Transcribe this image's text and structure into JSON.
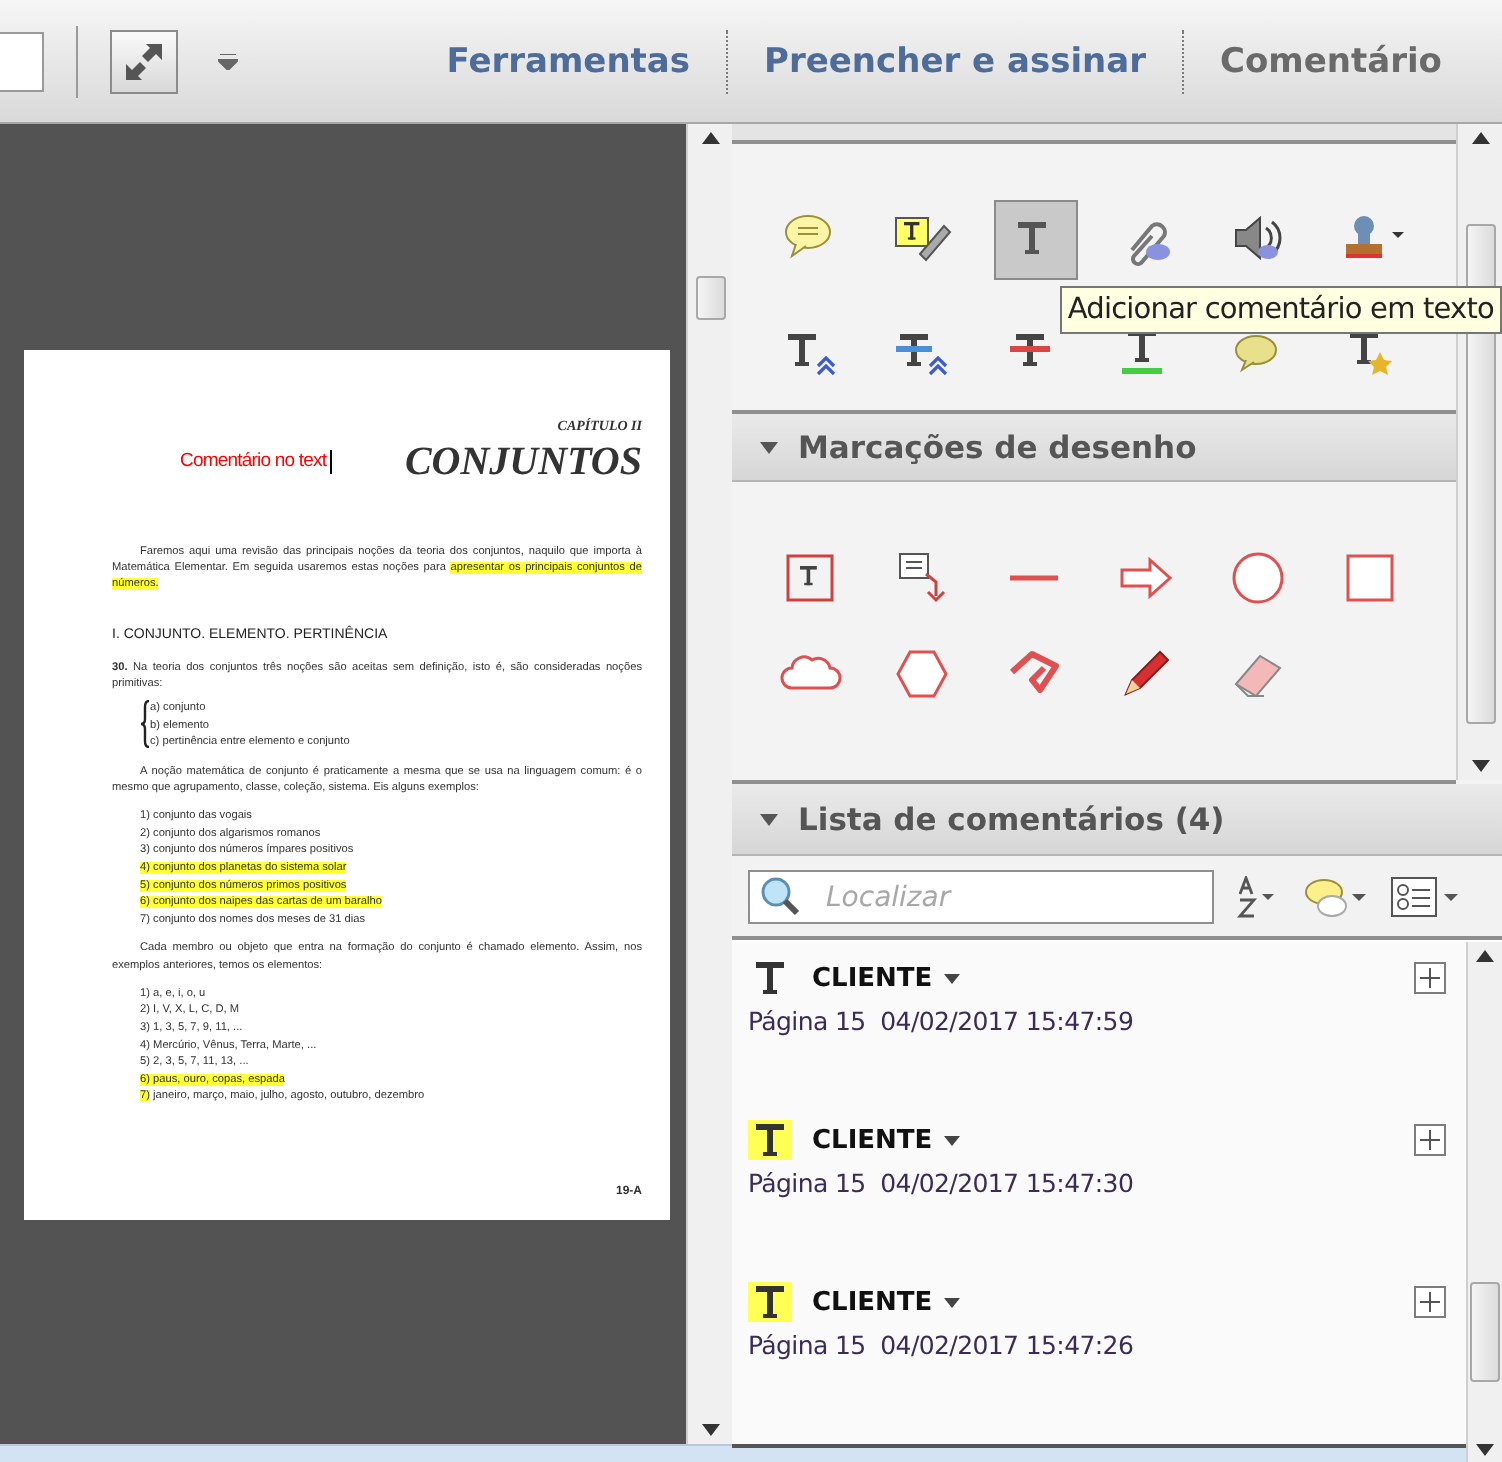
{
  "toolbar": {
    "tabs": [
      {
        "label": "Ferramentas",
        "selected": false
      },
      {
        "label": "Preencher e assinar",
        "selected": false
      },
      {
        "label": "Comentário",
        "selected": true
      }
    ]
  },
  "document": {
    "chapter": "CAPÍTULO II",
    "title": "CONJUNTOS",
    "comment": "Comentário no text",
    "blocks": [
      {
        "kind": "paragraph",
        "parts": [
          {
            "text": "Faremos aqui uma revisão das principais noções da teoria dos conjuntos, naquilo que importa à Matemática Elementar. Em seguida usaremos estas noções para ",
            "highlight": false
          },
          {
            "text": "apresentar os principais conjuntos de números.",
            "highlight": true
          }
        ]
      },
      {
        "kind": "heading",
        "parts": [
          {
            "text": "I.   CONJUNTO. ELEMENTO. PERTINÊNCIA",
            "highlight": false
          }
        ]
      },
      {
        "kind": "plain",
        "parts": [
          {
            "text": "**30.** Na teoria dos conjuntos três noções são aceitas sem definição, isto é, são consideradas noções primitivas:",
            "highlight": false
          }
        ]
      },
      {
        "kind": "brace_list",
        "items": [
          {
            "parts": [
              {
                "text": "a) conjunto",
                "highlight": false
              }
            ]
          },
          {
            "parts": [
              {
                "text": "b) elemento",
                "highlight": false
              }
            ]
          },
          {
            "parts": [
              {
                "text": "c) pertinência entre elemento e conjunto",
                "highlight": false
              }
            ]
          }
        ]
      },
      {
        "kind": "paragraph",
        "parts": [
          {
            "text": "A noção matemática de conjunto é praticamente a mesma que se usa na linguagem comum: é o mesmo que agrupamento, classe, coleção, sistema. Eis alguns exemplos:",
            "highlight": false
          }
        ]
      },
      {
        "kind": "list",
        "items": [
          {
            "parts": [
              {
                "text": "1) conjunto das vogais",
                "highlight": false
              }
            ]
          },
          {
            "parts": [
              {
                "text": "2) conjunto dos algarismos romanos",
                "highlight": false
              }
            ]
          },
          {
            "parts": [
              {
                "text": "3) conjunto dos números ímpares positivos",
                "highlight": false
              }
            ]
          },
          {
            "parts": [
              {
                "text": "4) conjunto dos planetas do sistema solar",
                "highlight": true
              }
            ]
          },
          {
            "parts": [
              {
                "text": "5) conjunto dos números primos positivos",
                "highlight": true
              }
            ]
          },
          {
            "parts": [
              {
                "text": "6) conjunto dos naipes das cartas de um baralho",
                "highlight": true
              }
            ]
          },
          {
            "parts": [
              {
                "text": "7) conjunto dos nomes dos meses de 31 dias",
                "highlight": false
              }
            ]
          }
        ]
      },
      {
        "kind": "paragraph",
        "parts": [
          {
            "text": "Cada membro ou objeto que entra na formação do conjunto é chamado elemento. Assim, nos exemplos anteriores, temos os elementos:",
            "highlight": false
          }
        ]
      },
      {
        "kind": "list",
        "items": [
          {
            "parts": [
              {
                "text": "1) a, e, i, o, u",
                "highlight": false
              }
            ]
          },
          {
            "parts": [
              {
                "text": "2) I, V, X, L, C, D, M",
                "highlight": false
              }
            ]
          },
          {
            "parts": [
              {
                "text": "3) 1, 3, 5, 7, 9, 11, ...",
                "highlight": false
              }
            ]
          },
          {
            "parts": [
              {
                "text": "4) Mercúrio, Vênus, Terra, Marte, ...",
                "highlight": false
              }
            ]
          },
          {
            "parts": [
              {
                "text": "5) 2, 3, 5, 7, 11, 13, ...",
                "highlight": false
              }
            ]
          },
          {
            "parts": [
              {
                "text": "6) paus, ouro, copas, espada",
                "highlight": true
              }
            ]
          },
          {
            "parts": [
              {
                "text": "7)",
                "highlight": true
              },
              {
                "text": " janeiro, março, maio, julho, agosto, outubro, dezembro",
                "highlight": false
              }
            ]
          }
        ]
      }
    ],
    "page_number": "19-A"
  },
  "annotations": {
    "tools": [
      {
        "kind": "note",
        "selected": false
      },
      {
        "kind": "text_edit",
        "selected": false
      },
      {
        "kind": "text",
        "selected": true
      },
      {
        "kind": "attach",
        "selected": false
      },
      {
        "kind": "sound",
        "selected": false
      },
      {
        "kind": "stamp",
        "selected": false
      },
      {
        "kind": "insert",
        "selected": false
      },
      {
        "kind": "replace",
        "selected": false
      },
      {
        "kind": "strike",
        "selected": false
      },
      {
        "kind": "underline",
        "selected": false
      },
      {
        "kind": "note_on_text",
        "selected": false
      },
      {
        "kind": "star_text",
        "selected": false
      }
    ],
    "tooltip": "Adicionar comentário em texto"
  },
  "drawing_markups": {
    "title": "Marcações de desenho",
    "expanded": true,
    "tools": [
      {
        "kind": "textbox"
      },
      {
        "kind": "callout"
      },
      {
        "kind": "line"
      },
      {
        "kind": "arrow"
      },
      {
        "kind": "oval"
      },
      {
        "kind": "rectangle"
      },
      {
        "kind": "cloud"
      },
      {
        "kind": "polygon"
      },
      {
        "kind": "polyline"
      },
      {
        "kind": "pencil"
      },
      {
        "kind": "eraser"
      }
    ]
  },
  "comment_list": {
    "title": "Lista de comentários (4)",
    "expanded": true,
    "search": {
      "placeholder": "Localizar"
    },
    "comments": [
      {
        "author": "CLIENTE",
        "meta": "Página 15  04/02/2017 15:47:59",
        "highlighted": false
      },
      {
        "author": "CLIENTE",
        "meta": "Página 15  04/02/2017 15:47:30",
        "highlighted": true
      },
      {
        "author": "CLIENTE",
        "meta": "Página 15  04/02/2017 15:47:26",
        "highlighted": true
      }
    ]
  }
}
